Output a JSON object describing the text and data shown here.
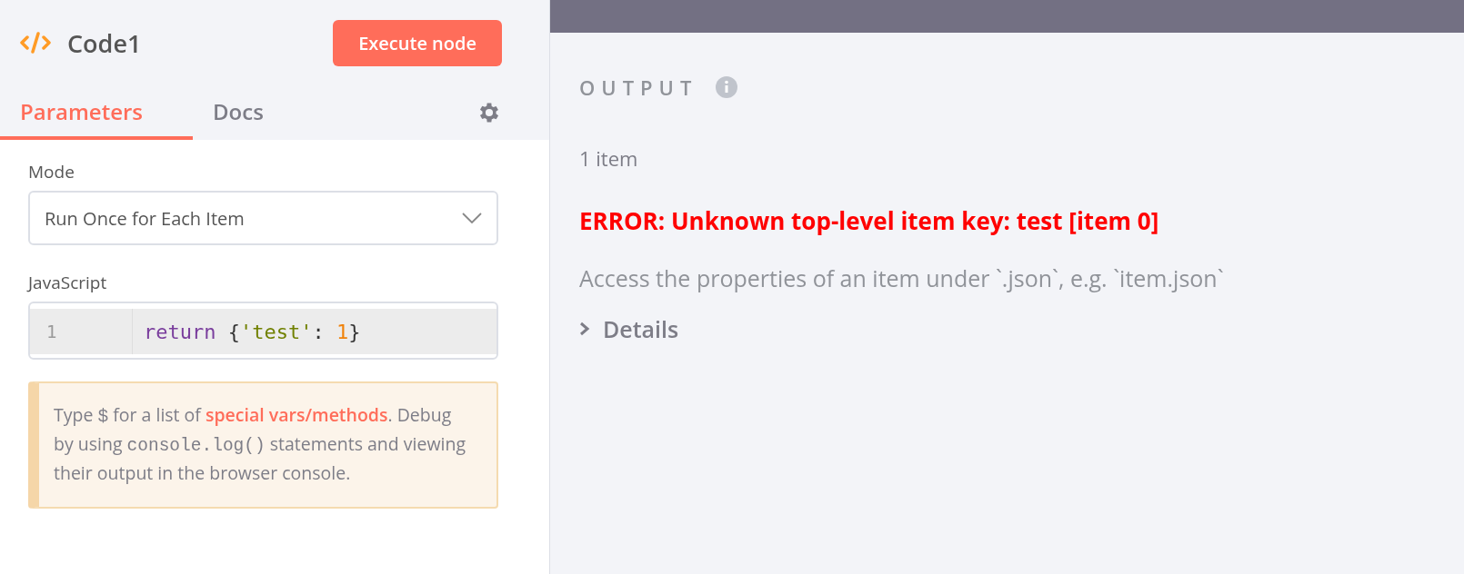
{
  "node": {
    "title": "Code1",
    "execute_button": "Execute node"
  },
  "tabs": [
    {
      "label": "Parameters",
      "selected": true
    },
    {
      "label": "Docs",
      "selected": false
    }
  ],
  "mode": {
    "label": "Mode",
    "value": "Run Once for Each Item"
  },
  "editor": {
    "label": "JavaScript",
    "lines": [
      {
        "number": "1",
        "active": true,
        "tokens": [
          {
            "kind": "keyword",
            "text": "return"
          },
          {
            "kind": "plain",
            "text": " {"
          },
          {
            "kind": "string",
            "text": "'test'"
          },
          {
            "kind": "plain",
            "text": ": "
          },
          {
            "kind": "number",
            "text": "1"
          },
          {
            "kind": "plain",
            "text": "}"
          }
        ]
      }
    ]
  },
  "hint": [
    {
      "kind": "text",
      "text": "Type "
    },
    {
      "kind": "code",
      "text": "$"
    },
    {
      "kind": "text",
      "text": " for a list of "
    },
    {
      "kind": "link",
      "text": "special vars/methods"
    },
    {
      "kind": "text",
      "text": ". Debug by using "
    },
    {
      "kind": "code",
      "text": "console.log()"
    },
    {
      "kind": "text",
      "text": " statements and viewing their output in the browser console."
    }
  ],
  "output": {
    "title": "OUTPUT",
    "count": "1 item",
    "error": "ERROR: Unknown top-level item key: test [item 0]",
    "description": "Access the properties of an item under `.json`, e.g. `item.json`",
    "details": {
      "label": "Details",
      "expanded": false
    }
  }
}
